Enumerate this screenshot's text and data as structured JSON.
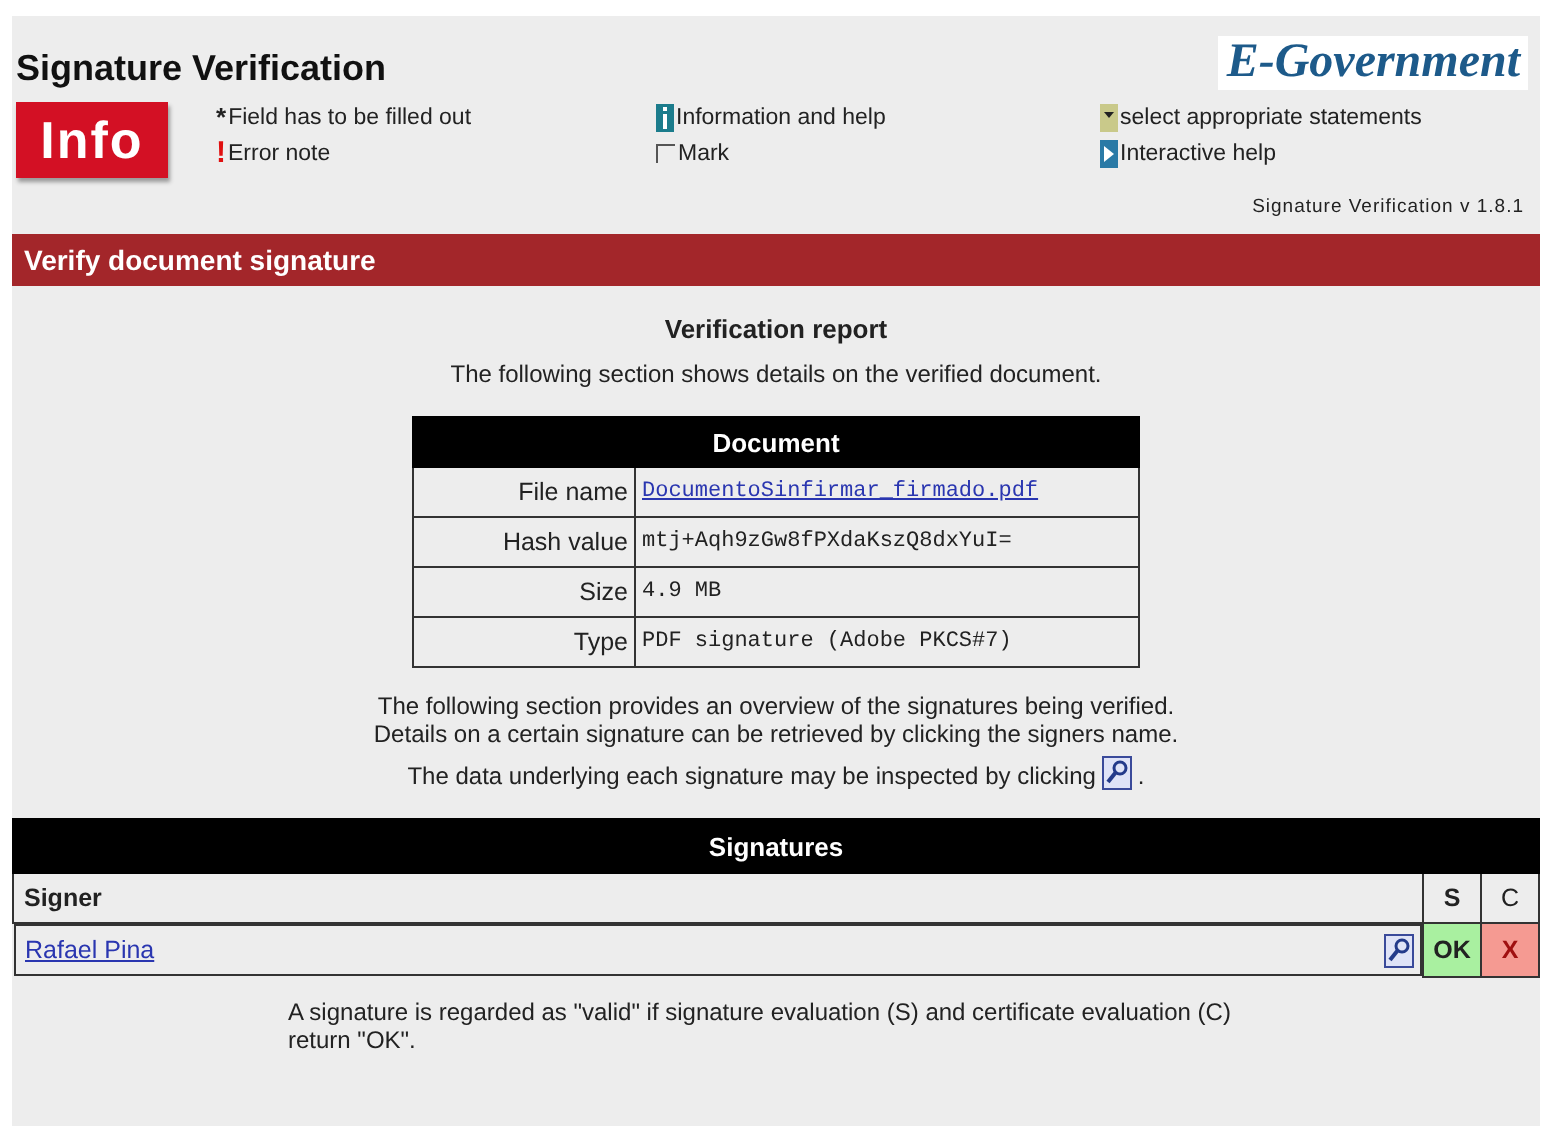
{
  "header": {
    "title": "Signature Verification",
    "logo": "E-Government",
    "badge": "Info",
    "version": "Signature Verification v 1.8.1"
  },
  "legend": [
    {
      "kind": "asterisk",
      "symbol": "*",
      "label": "Field has to be filled out"
    },
    {
      "kind": "error",
      "symbol": "!",
      "label": "Error note"
    },
    {
      "kind": "info",
      "label": "Information and help"
    },
    {
      "kind": "mark",
      "label": "Mark"
    },
    {
      "kind": "select",
      "label": "select appropriate statements"
    },
    {
      "kind": "interactive",
      "label": "Interactive help"
    }
  ],
  "section_title": "Verify document signature",
  "report": {
    "title": "Verification report",
    "intro": "The following section shows details on the verified document."
  },
  "document_table": {
    "title": "Document",
    "rows": [
      {
        "label": "File name",
        "value": "DocumentoSinfirmar_firmado.pdf",
        "kind": "link"
      },
      {
        "label": "Hash value",
        "value": "mtj+Aqh9zGw8fPXdaKszQ8dxYuI=",
        "kind": "text"
      },
      {
        "label": "Size",
        "value": "4.9 MB",
        "kind": "text"
      },
      {
        "label": "Type",
        "value": "PDF signature (Adobe PKCS#7)",
        "kind": "text"
      }
    ]
  },
  "overview": [
    "The following section provides an overview of the signatures being verified.",
    "Details on a certain signature can be retrieved by clicking the signers name.",
    "The data underlying each signature may be inspected by clicking",
    "."
  ],
  "signatures_table": {
    "title": "Signatures",
    "columns": [
      "Signer",
      "S",
      "C"
    ],
    "rows": [
      {
        "signer": "Rafael Pina",
        "s": {
          "text": "OK",
          "passed": true
        },
        "c": {
          "text": "X",
          "passed": false
        }
      }
    ]
  },
  "footnote": "A signature is regarded as \"valid\" if signature evaluation (S) and certificate evaluation (C) return \"OK\"."
}
